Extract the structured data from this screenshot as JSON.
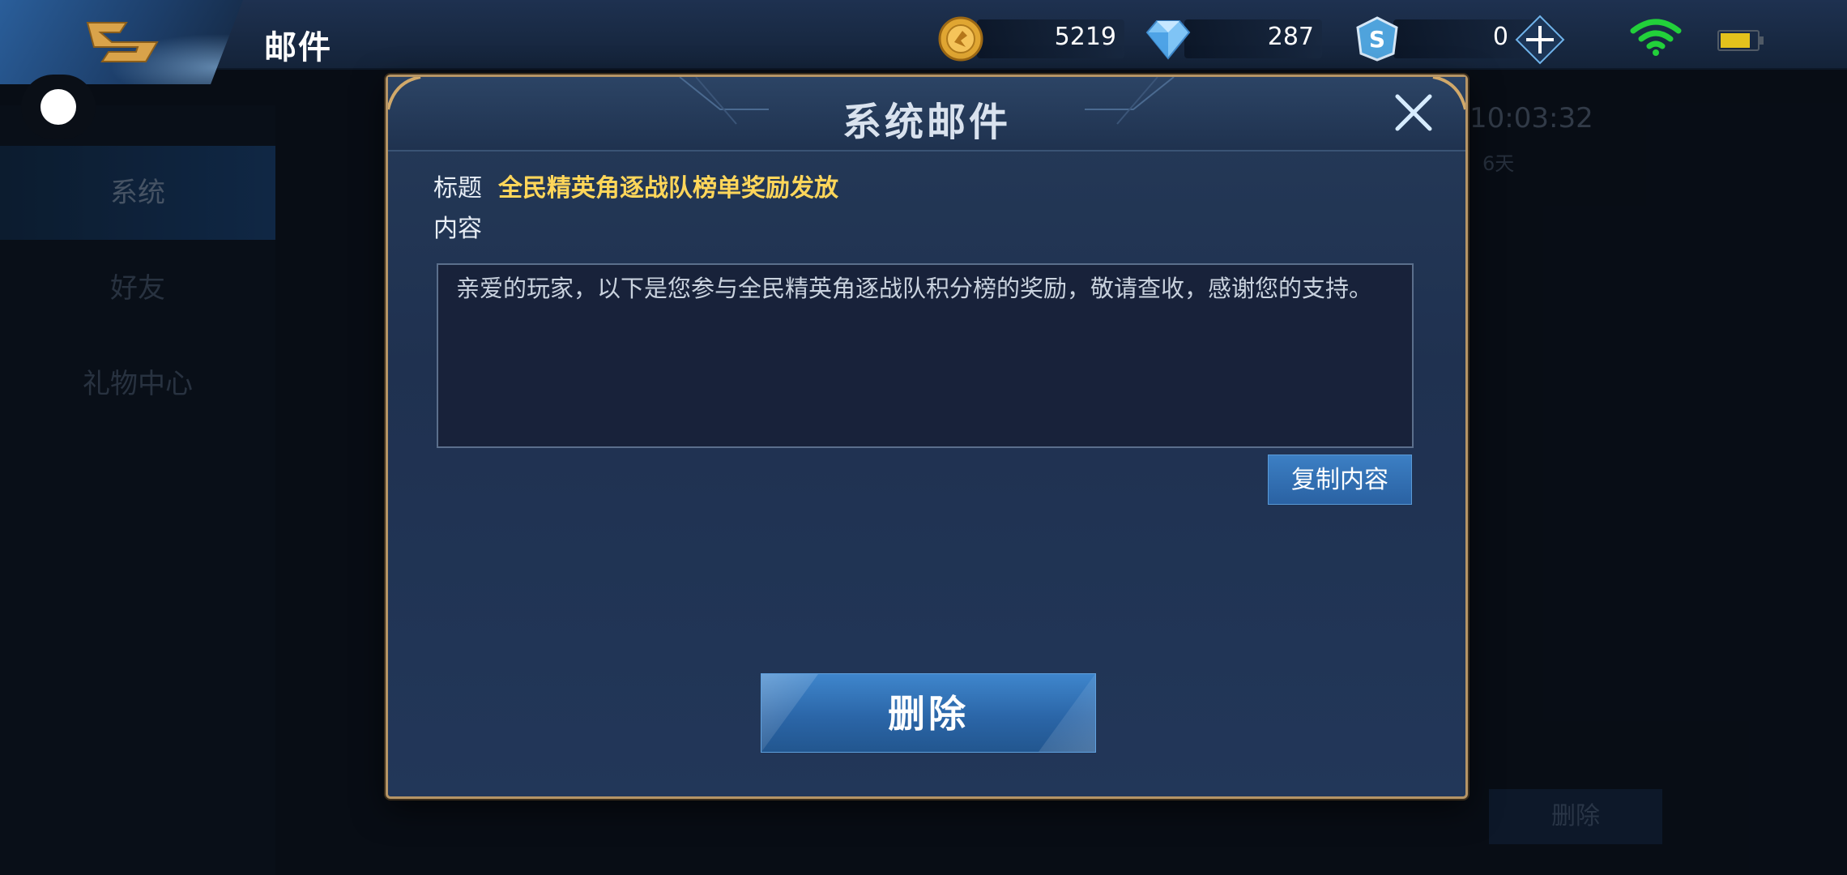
{
  "header": {
    "title": "邮件",
    "currencies": {
      "gold": "5219",
      "diamond": "287",
      "ticket": "0"
    }
  },
  "sidebar": {
    "items": [
      {
        "label": "系统",
        "active": true
      },
      {
        "label": "好友",
        "active": false
      },
      {
        "label": "礼物中心",
        "active": false
      }
    ]
  },
  "background": {
    "time": "10:03:32",
    "days": "6天",
    "delete_label": "删除"
  },
  "modal": {
    "title": "系统邮件",
    "subject_label": "标题",
    "subject": "全民精英角逐战队榜单奖励发放",
    "content_label": "内容",
    "content": "亲爱的玩家，以下是您参与全民精英角逐战队积分榜的奖励，敬请查收，感谢您的支持。",
    "copy_label": "复制内容",
    "delete_label": "删除"
  },
  "colors": {
    "accent_blue": "#2b66a8",
    "subject_yellow": "#ffd65a",
    "frame_gold": "#b69566"
  },
  "icons": [
    "back-icon",
    "gold-coin-icon",
    "diamond-icon",
    "ticket-icon",
    "add-icon",
    "wifi-icon",
    "battery-icon",
    "close-icon"
  ]
}
